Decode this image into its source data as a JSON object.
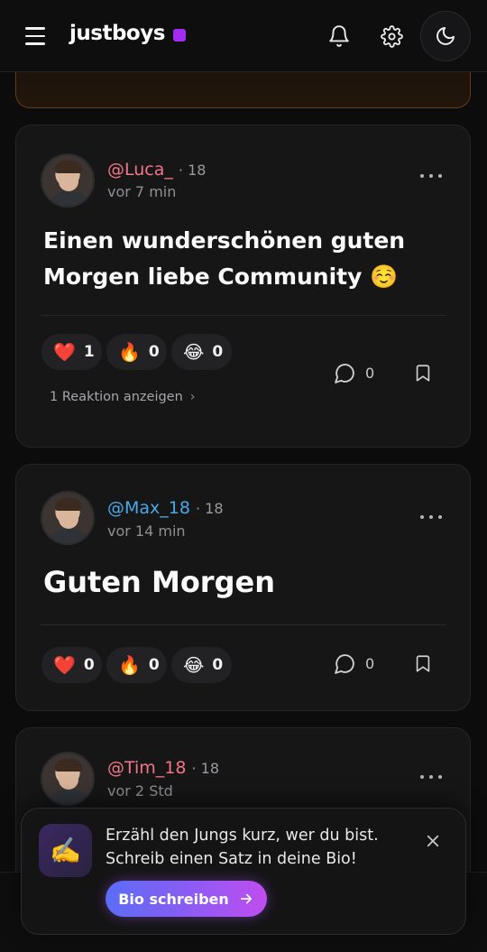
{
  "header": {
    "logo_text": "justboys",
    "logo_dot_color": "#a22cf2",
    "icons": [
      "menu-icon",
      "bell-icon",
      "gear-icon",
      "moon-icon"
    ]
  },
  "posts": [
    {
      "username": "@Luca_",
      "username_color": "#f2768a",
      "age": "· 18",
      "time": "vor 7 min",
      "text": "Einen wunderschönen guten Morgen liebe Community ☺️",
      "reactions": [
        {
          "emoji": "❤️",
          "count": "1"
        },
        {
          "emoji": "🔥",
          "count": "0"
        },
        {
          "emoji": "😂",
          "count": "0"
        }
      ],
      "comments": "0",
      "show_reactions": "1 Reaktion anzeigen"
    },
    {
      "username": "@Max_18",
      "username_color": "#4aa8e8",
      "age": "· 18",
      "time": "vor 14 min",
      "text": "Guten Morgen",
      "reactions": [
        {
          "emoji": "❤️",
          "count": "0"
        },
        {
          "emoji": "🔥",
          "count": "0"
        },
        {
          "emoji": "😂",
          "count": "0"
        }
      ],
      "comments": "0"
    },
    {
      "username": "@Tim_18",
      "username_color": "#f2768a",
      "age": "· 18",
      "time": "vor 2 Std"
    }
  ],
  "toast": {
    "icon": "✍️",
    "text": "Erzähl den Jungs kurz, wer du bist. Schreib einen Satz in deine Bio!",
    "button_label": "Bio schreiben"
  }
}
